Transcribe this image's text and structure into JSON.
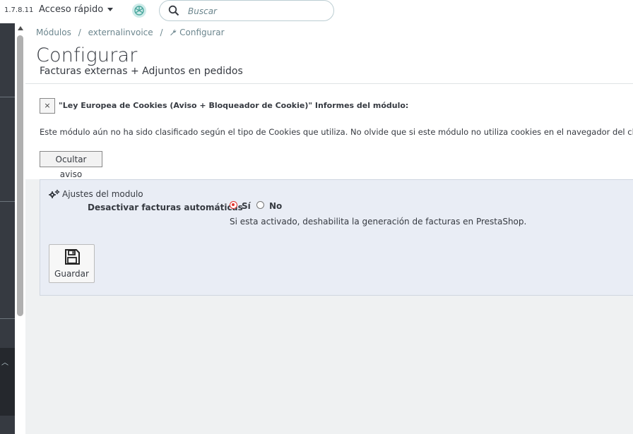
{
  "header": {
    "version": "1.7.8.11",
    "quick_access": "Acceso rápido",
    "search_placeholder": "Buscar"
  },
  "breadcrumb": [
    "Módulos",
    "/",
    "externalinvoice",
    "/",
    "Configurar"
  ],
  "page": {
    "title": "Configurar",
    "subtitle": "Facturas externas + Adjuntos en pedidos"
  },
  "notice": {
    "close_label": "×",
    "title": "\"Ley Europea de Cookies (Aviso + Bloqueador de Cookie)\" Informes del módulo:",
    "text": "Este módulo aún no ha sido clasificado según el tipo de Cookies que utiliza. No olvide que si este módulo no utiliza cookies en el navegador del cliente",
    "hide_button": "Ocultar aviso"
  },
  "panel": {
    "heading": "Ajustes del modulo",
    "field_label": "Desactivar facturas automáticas",
    "option_yes": "Sí",
    "option_no": "No",
    "selected": "Sí",
    "help_text": "Si esta activado, deshabilita la generación de facturas en PrestaShop.",
    "save_button": "Guardar"
  },
  "colors": {
    "accent_radio": "#e2322b",
    "sidebar": "#363a41",
    "panel_bg": "#e9edf5",
    "logo": "#74c7bf"
  },
  "icons": {
    "logo": "openai-logo-icon",
    "search": "search-icon",
    "wrench": "wrench-icon",
    "cogs": "cogs-icon",
    "save": "floppy-disk-icon"
  }
}
